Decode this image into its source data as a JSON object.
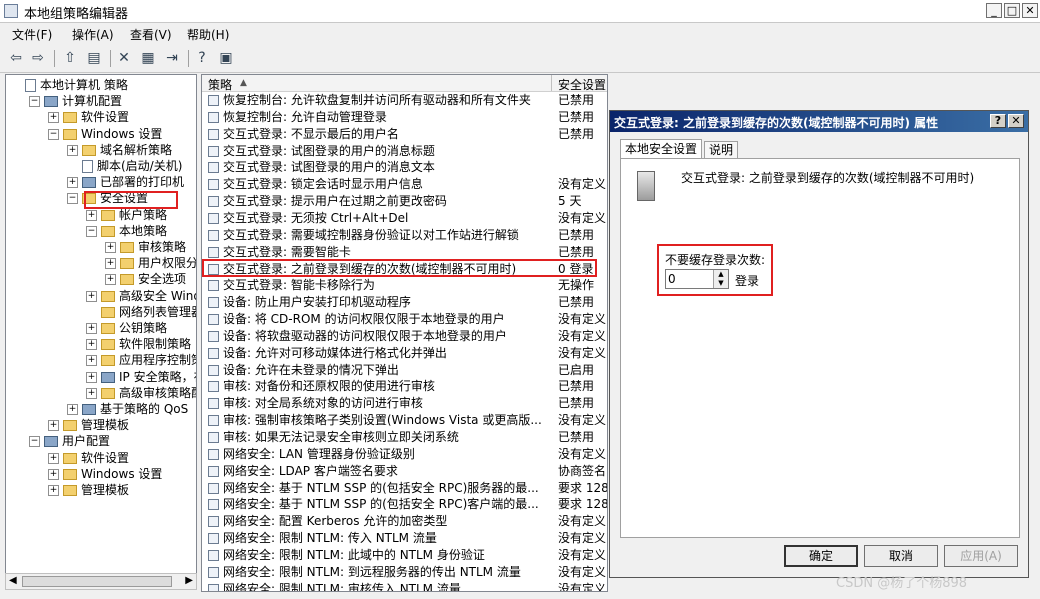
{
  "window": {
    "title": "本地组策略编辑器",
    "controls": [
      "_",
      "□",
      "✕"
    ]
  },
  "menu": [
    "文件(F)",
    "操作(A)",
    "查看(V)",
    "帮助(H)"
  ],
  "tree": [
    {
      "label": "本地计算机 策略",
      "indent": 0,
      "exp": "",
      "icon": "doc"
    },
    {
      "label": "计算机配置",
      "indent": 1,
      "exp": "−",
      "icon": "pc"
    },
    {
      "label": "软件设置",
      "indent": 2,
      "exp": "+",
      "icon": "fold"
    },
    {
      "label": "Windows 设置",
      "indent": 2,
      "exp": "−",
      "icon": "fold"
    },
    {
      "label": "域名解析策略",
      "indent": 3,
      "exp": "+",
      "icon": "fold"
    },
    {
      "label": "脚本(启动/关机)",
      "indent": 3,
      "exp": "",
      "icon": "doc"
    },
    {
      "label": "已部署的打印机",
      "indent": 3,
      "exp": "+",
      "icon": "pc"
    },
    {
      "label": "安全设置",
      "indent": 3,
      "exp": "−",
      "icon": "fold"
    },
    {
      "label": "帐户策略",
      "indent": 4,
      "exp": "+",
      "icon": "fold"
    },
    {
      "label": "本地策略",
      "indent": 4,
      "exp": "−",
      "icon": "fold"
    },
    {
      "label": "审核策略",
      "indent": 5,
      "exp": "+",
      "icon": "fold"
    },
    {
      "label": "用户权限分配",
      "indent": 5,
      "exp": "+",
      "icon": "fold"
    },
    {
      "label": "安全选项",
      "indent": 5,
      "exp": "+",
      "icon": "fold"
    },
    {
      "label": "高级安全 Window",
      "indent": 4,
      "exp": "+",
      "icon": "fold"
    },
    {
      "label": "网络列表管理器策",
      "indent": 4,
      "exp": "",
      "icon": "fold"
    },
    {
      "label": "公钥策略",
      "indent": 4,
      "exp": "+",
      "icon": "fold"
    },
    {
      "label": "软件限制策略",
      "indent": 4,
      "exp": "+",
      "icon": "fold"
    },
    {
      "label": "应用程序控制策略",
      "indent": 4,
      "exp": "+",
      "icon": "fold"
    },
    {
      "label": "IP 安全策略，在",
      "indent": 4,
      "exp": "+",
      "icon": "pc"
    },
    {
      "label": "高级审核策略配置",
      "indent": 4,
      "exp": "+",
      "icon": "fold"
    },
    {
      "label": "基于策略的 QoS",
      "indent": 3,
      "exp": "+",
      "icon": "pc"
    },
    {
      "label": "管理模板",
      "indent": 2,
      "exp": "+",
      "icon": "fold"
    },
    {
      "label": "用户配置",
      "indent": 1,
      "exp": "−",
      "icon": "pc"
    },
    {
      "label": "软件设置",
      "indent": 2,
      "exp": "+",
      "icon": "fold"
    },
    {
      "label": "Windows 设置",
      "indent": 2,
      "exp": "+",
      "icon": "fold"
    },
    {
      "label": "管理模板",
      "indent": 2,
      "exp": "+",
      "icon": "fold"
    }
  ],
  "list": {
    "col_policy": "策略",
    "col_setting": "安全设置",
    "rows": [
      [
        "恢复控制台: 允许软盘复制并访问所有驱动器和所有文件夹",
        "已禁用"
      ],
      [
        "恢复控制台: 允许自动管理登录",
        "已禁用"
      ],
      [
        "交互式登录: 不显示最后的用户名",
        "已禁用"
      ],
      [
        "交互式登录: 试图登录的用户的消息标题",
        ""
      ],
      [
        "交互式登录: 试图登录的用户的消息文本",
        ""
      ],
      [
        "交互式登录: 锁定会话时显示用户信息",
        "没有定义"
      ],
      [
        "交互式登录: 提示用户在过期之前更改密码",
        "5 天"
      ],
      [
        "交互式登录: 无须按 Ctrl+Alt+Del",
        "没有定义"
      ],
      [
        "交互式登录: 需要域控制器身份验证以对工作站进行解锁",
        "已禁用"
      ],
      [
        "交互式登录: 需要智能卡",
        "已禁用"
      ],
      [
        "交互式登录: 之前登录到缓存的次数(域控制器不可用时)",
        "0 登录"
      ],
      [
        "交互式登录: 智能卡移除行为",
        "无操作"
      ],
      [
        "设备: 防止用户安装打印机驱动程序",
        "已禁用"
      ],
      [
        "设备: 将 CD-ROM 的访问权限仅限于本地登录的用户",
        "没有定义"
      ],
      [
        "设备: 将软盘驱动器的访问权限仅限于本地登录的用户",
        "没有定义"
      ],
      [
        "设备: 允许对可移动媒体进行格式化并弹出",
        "没有定义"
      ],
      [
        "设备: 允许在未登录的情况下弹出",
        "已启用"
      ],
      [
        "审核: 对备份和还原权限的使用进行审核",
        "已禁用"
      ],
      [
        "审核: 对全局系统对象的访问进行审核",
        "已禁用"
      ],
      [
        "审核: 强制审核策略子类别设置(Windows Vista 或更高版...",
        "没有定义"
      ],
      [
        "审核: 如果无法记录安全审核则立即关闭系统",
        "已禁用"
      ],
      [
        "网络安全: LAN 管理器身份验证级别",
        "没有定义"
      ],
      [
        "网络安全: LDAP 客户端签名要求",
        "协商签名"
      ],
      [
        "网络安全: 基于 NTLM SSP 的(包括安全 RPC)服务器的最...",
        "要求 128"
      ],
      [
        "网络安全: 基于 NTLM SSP 的(包括安全 RPC)客户端的最...",
        "要求 128"
      ],
      [
        "网络安全: 配置 Kerberos 允许的加密类型",
        "没有定义"
      ],
      [
        "网络安全: 限制 NTLM: 传入 NTLM 流量",
        "没有定义"
      ],
      [
        "网络安全: 限制 NTLM: 此域中的 NTLM 身份验证",
        "没有定义"
      ],
      [
        "网络安全: 限制 NTLM: 到远程服务器的传出 NTLM 流量",
        "没有定义"
      ],
      [
        "网络安全: 限制 NTLM: 审核传入 NTLM 流量",
        "没有定义"
      ]
    ]
  },
  "dialog": {
    "title": "交互式登录: 之前登录到缓存的次数(域控制器不可用时) 属性",
    "help_btn": "?",
    "close_btn": "✕",
    "tab_local": "本地安全设置",
    "tab_explain": "说明",
    "description": "交互式登录: 之前登录到缓存的次数(域控制器不可用时)",
    "field_label": "不要缓存登录次数:",
    "field_value": "0",
    "field_unit": "登录",
    "ok": "确定",
    "cancel": "取消",
    "apply": "应用(A)"
  },
  "watermark": "CSDN @杨了个杨898"
}
